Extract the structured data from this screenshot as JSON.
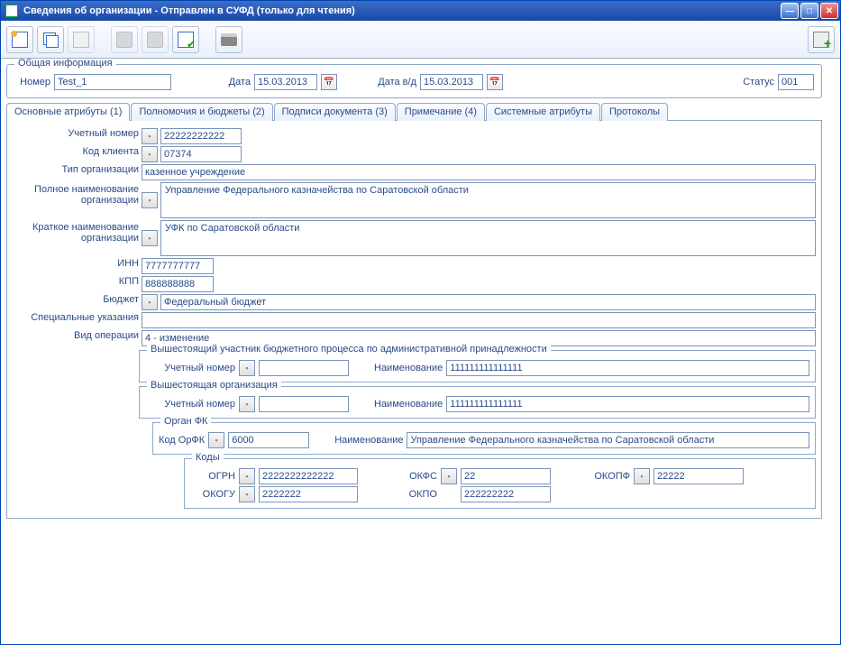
{
  "window": {
    "title": "Сведения об организации - Отправлен в СУФД (только для чтения)"
  },
  "general": {
    "legend": "Общая информация",
    "number_label": "Номер",
    "number": "Test_1",
    "date_label": "Дата",
    "date": "15.03.2013",
    "date_vd_label": "Дата в/д",
    "date_vd": "15.03.2013",
    "status_label": "Статус",
    "status": "001"
  },
  "tabs": [
    {
      "label": "Основные атрибуты (1)"
    },
    {
      "label": "Полномочия и бюджеты (2)"
    },
    {
      "label": "Подписи документа (3)"
    },
    {
      "label": "Примечание (4)"
    },
    {
      "label": "Системные атрибуты"
    },
    {
      "label": "Протоколы"
    }
  ],
  "main": {
    "acct_no_label": "Учетный номер",
    "acct_no": "22222222222",
    "client_code_label": "Код клиента",
    "client_code": "07374",
    "org_type_label": "Тип организации",
    "org_type": "казенное учреждение",
    "full_name_label": "Полное наименование организации",
    "full_name": "Управление Федерального казначейства по Саратовской области",
    "short_name_label": "Краткое наименование организации",
    "short_name": "УФК по Саратовской области",
    "inn_label": "ИНН",
    "inn": "7777777777",
    "kpp_label": "КПП",
    "kpp": "888888888",
    "budget_label": "Бюджет",
    "budget": "Федеральный бюджет",
    "special_label": "Специальные указания",
    "special": "",
    "op_type_label": "Вид операции",
    "op_type": "4 - изменение"
  },
  "superior_budget": {
    "legend": "Вышестоящий участник бюджетного процесса по административной принадлежности",
    "acct_label": "Учетный номер",
    "acct": "",
    "name_label": "Наименование",
    "name": "111111111111111"
  },
  "superior_org": {
    "legend": "Вышестоящая организация",
    "acct_label": "Учетный номер",
    "acct": "",
    "name_label": "Наименование",
    "name": "111111111111111"
  },
  "fk": {
    "legend": "Орган ФК",
    "code_label": "Код ОрФК",
    "code": "6000",
    "name_label": "Наименование",
    "name": "Управление Федерального казначейства по Саратовской области"
  },
  "codes": {
    "legend": "Коды",
    "ogrn_label": "ОГРН",
    "ogrn": "2222222222222",
    "okfs_label": "ОКФС",
    "okfs": "22",
    "okopf_label": "ОКОПФ",
    "okopf": "22222",
    "okogu_label": "ОКОГУ",
    "okogu": "2222222",
    "okpo_label": "ОКПО",
    "okpo": "222222222"
  }
}
